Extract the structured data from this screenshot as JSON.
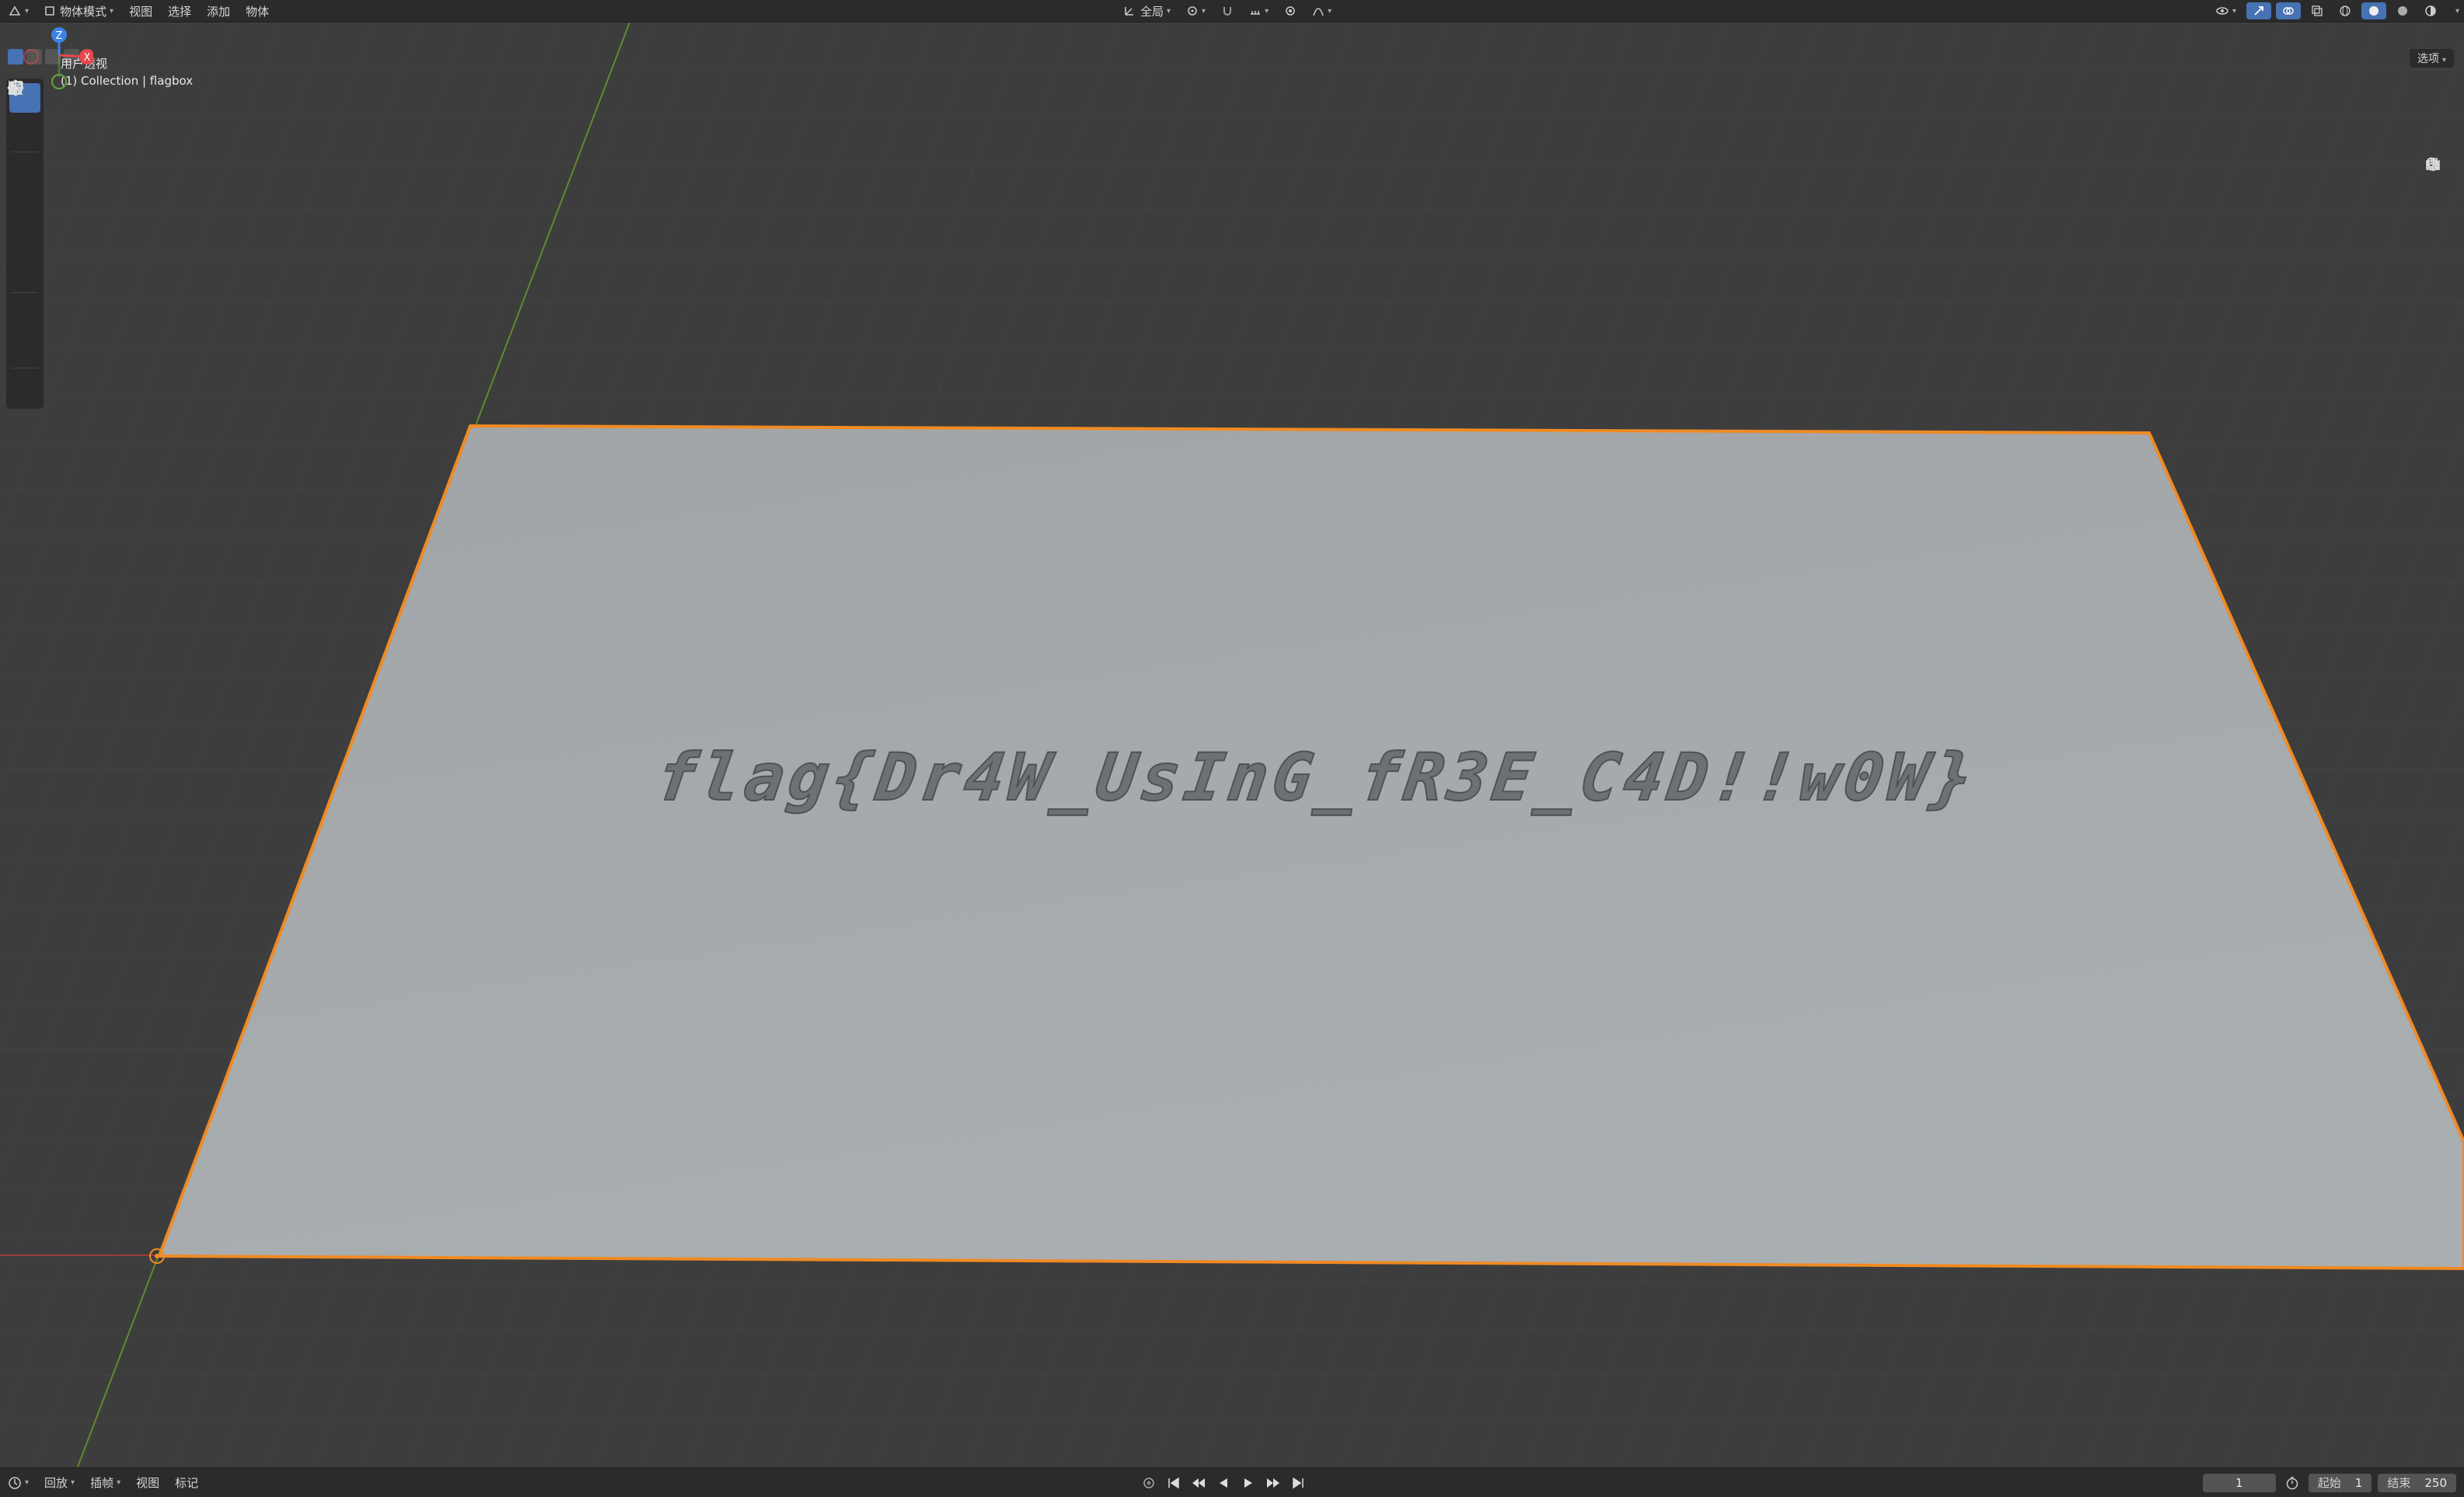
{
  "header": {
    "mode": "物体模式",
    "menus": [
      "视图",
      "选择",
      "添加",
      "物体"
    ],
    "transform_orientation": "全局",
    "options_label": "选项"
  },
  "viewport": {
    "view_name": "用户透视",
    "collection_info": "(1) Collection | flagbox",
    "engraved_text": "flag{Dr4W_UsInG_fR3E_C4D!!w0W}"
  },
  "toolbar": {
    "tools": [
      "select-box",
      "cursor",
      "move",
      "rotate",
      "scale",
      "transform",
      "annotate",
      "measure",
      "add-cube"
    ],
    "active": "select-box"
  },
  "gizmo": {
    "axes": [
      "X",
      "Y",
      "Z"
    ],
    "colors": {
      "x": "#e5484d",
      "y": "#68a340",
      "z": "#3c82e6"
    }
  },
  "timeline": {
    "menus": [
      "回放",
      "插帧",
      "视图",
      "标记"
    ],
    "current_frame": "1",
    "start_label": "起始",
    "start_value": "1",
    "end_label": "结束",
    "end_value": "250"
  },
  "colors": {
    "selection_outline": "#f08a24",
    "accent": "#4772b3",
    "plane": "#9fa3a6"
  }
}
